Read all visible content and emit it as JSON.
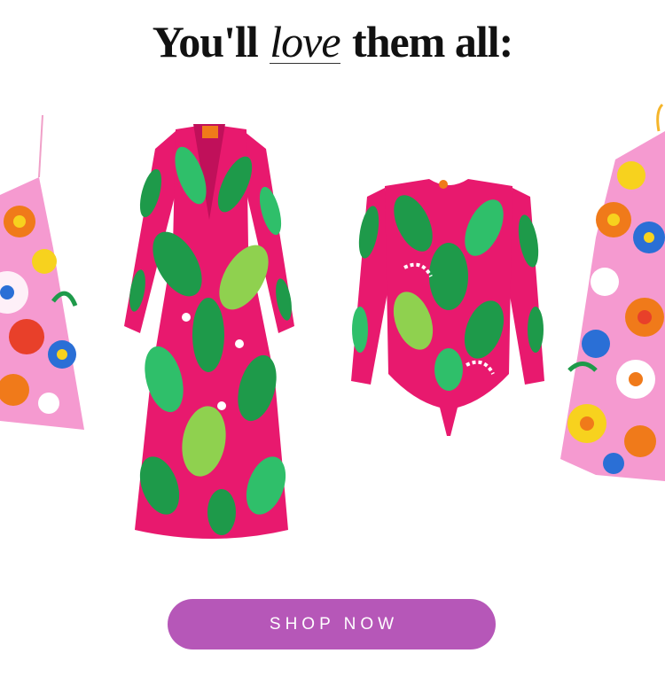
{
  "headline": {
    "before": "You'll",
    "emphasis": "love",
    "after": "them all:"
  },
  "cta": {
    "label": "SHOP NOW"
  },
  "colors": {
    "button": "#b657b8",
    "hot_pink": "#e8196e",
    "leaf_green": "#1e9a4a",
    "light_pink": "#f59ad0",
    "orange": "#f07a1a",
    "yellow": "#f7d21e"
  },
  "products": [
    {
      "name": "floral slip mini dress (cropped left)"
    },
    {
      "name": "pink tropical print long-sleeve maxi dress"
    },
    {
      "name": "pink tropical print long-sleeve bodysuit"
    },
    {
      "name": "floral one-shoulder mini dress (cropped right)"
    }
  ]
}
